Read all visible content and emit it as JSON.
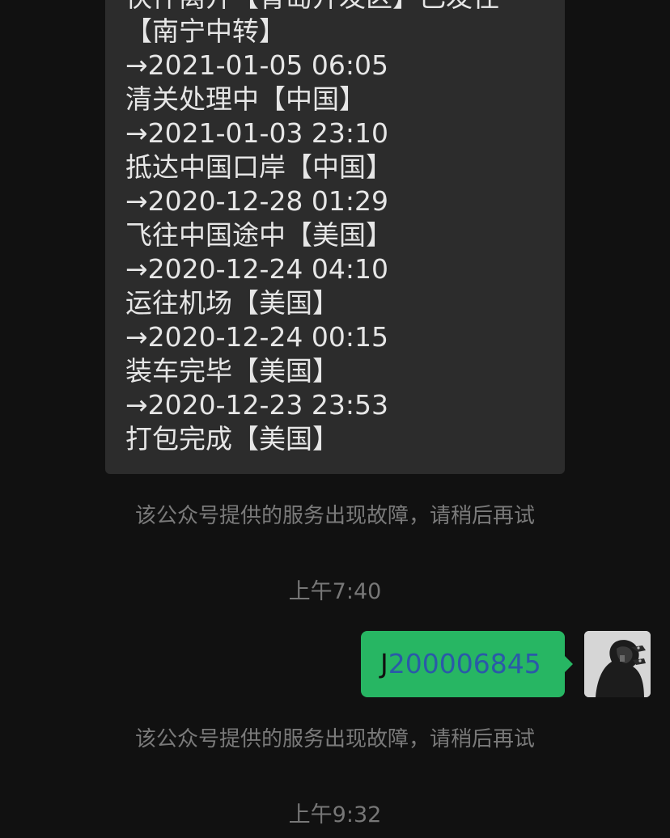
{
  "incoming_message": {
    "lines": [
      "快件离开【青岛开发区】已发往",
      "【南宁中转】",
      "→2021-01-05 06:05",
      "清关处理中【中国】",
      "→2021-01-03 23:10",
      "抵达中国口岸【中国】",
      "→2020-12-28 01:29",
      "飞往中国途中【美国】",
      "→2020-12-24 04:10",
      "运往机场【美国】",
      "→2020-12-24 00:15",
      "装车完毕【美国】",
      "→2020-12-23 23:53",
      "打包完成【美国】"
    ]
  },
  "system_notes": [
    "该公众号提供的服务出现故障，请稍后再试",
    "该公众号提供的服务出现故障，请稍后再试"
  ],
  "timestamps": [
    "上午7:40",
    "上午9:32"
  ],
  "outgoing_message": {
    "prefix": "J",
    "number": "200006845"
  },
  "colors": {
    "background": "#111111",
    "incoming_bubble": "#2c2c2c",
    "outgoing_bubble": "#27b663",
    "link_number": "#2a5aa8"
  },
  "icons": {
    "avatar": "user-avatar-hooded-figure"
  }
}
